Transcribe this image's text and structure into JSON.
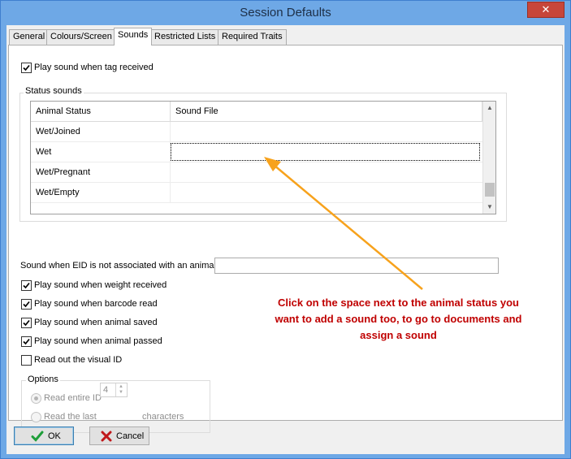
{
  "window": {
    "title": "Session Defaults",
    "close_glyph": "✕"
  },
  "tabs": [
    {
      "label": "General"
    },
    {
      "label": "Colours/Screen"
    },
    {
      "label": "Sounds",
      "active": true
    },
    {
      "label": "Restricted Lists"
    },
    {
      "label": "Required Traits"
    }
  ],
  "sounds": {
    "play_tag": {
      "label": "Play sound when tag received",
      "checked": true
    },
    "status_group_title": "Status sounds",
    "grid": {
      "col_status": "Animal Status",
      "col_file": "Sound File",
      "rows": [
        {
          "status": "Wet/Joined",
          "file": ""
        },
        {
          "status": "Wet",
          "file": "",
          "focused": true
        },
        {
          "status": "Wet/Pregnant",
          "file": ""
        },
        {
          "status": "Wet/Empty",
          "file": ""
        }
      ]
    },
    "eid_label": "Sound when EID is not associated with an animal",
    "eid_value": "",
    "weight": {
      "label": "Play sound when weight received",
      "checked": true
    },
    "barcode": {
      "label": "Play sound when barcode read",
      "checked": true
    },
    "saved": {
      "label": "Play sound when animal saved",
      "checked": true
    },
    "passed": {
      "label": "Play sound when animal passed",
      "checked": true
    },
    "visual_id": {
      "label": "Read out the visual ID",
      "checked": false
    },
    "options": {
      "title": "Options",
      "entire": {
        "label": "Read entire ID",
        "selected": true
      },
      "last": {
        "label": "Read the last",
        "selected": false
      },
      "count": "4",
      "characters": "characters"
    }
  },
  "annotation": {
    "text": "Click on the space next to the animal status you want to add a sound too, to go to documents and assign a sound",
    "color": "#c00000",
    "arrow_color": "#f7a21c"
  },
  "buttons": {
    "ok": "OK",
    "cancel": "Cancel"
  },
  "icons": {
    "ok": "check-icon",
    "cancel": "x-icon"
  },
  "colors": {
    "titlebar": "#6ea8e6",
    "close": "#c7463a"
  }
}
